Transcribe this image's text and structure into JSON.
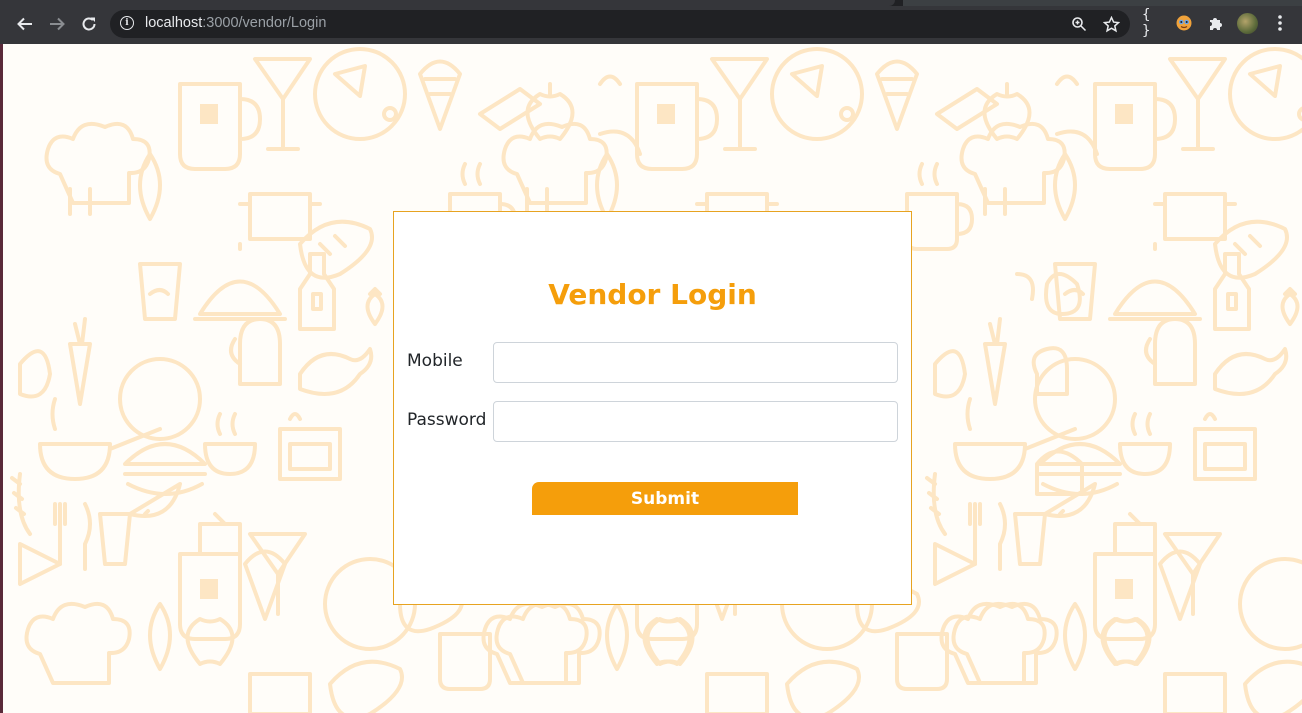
{
  "browser": {
    "url_host": "localhost",
    "url_path": ":3000/vendor/Login",
    "icons": {
      "back": "arrow-left-icon",
      "forward": "arrow-right-icon",
      "reload": "reload-icon",
      "site_info": "info-icon",
      "zoom": "zoom-icon",
      "bookmark": "star-icon",
      "json_ext": "curly-braces-icon",
      "face_ext": "face-extension-icon",
      "extensions": "puzzle-icon",
      "profile": "avatar-icon",
      "menu": "three-dots-icon"
    },
    "json_ext_text": "{ }"
  },
  "login": {
    "title": "Vendor Login",
    "mobile_label": "Mobile",
    "mobile_value": "",
    "password_label": "Password",
    "password_value": "",
    "submit_label": "Submit"
  },
  "colors": {
    "accent": "#f59e0b",
    "card_border": "#e7a320",
    "pattern_stroke": "#fde6c4"
  }
}
